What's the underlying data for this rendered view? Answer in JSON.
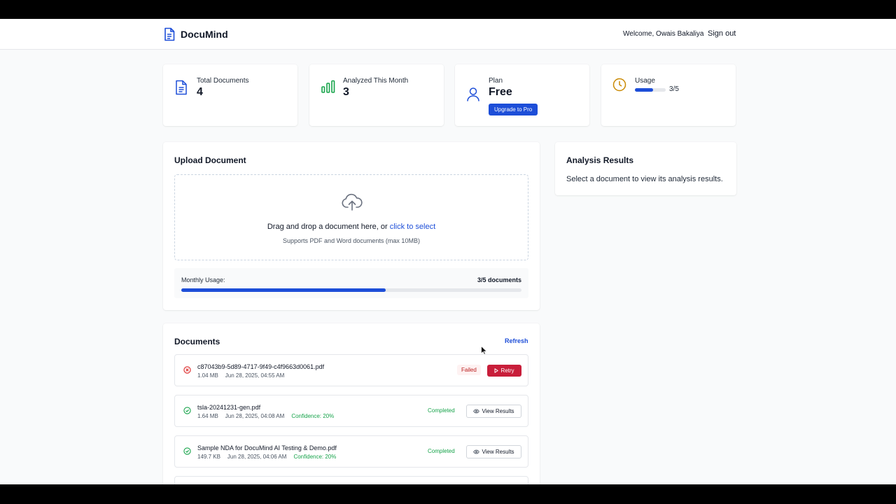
{
  "header": {
    "app_name": "DocuMind",
    "welcome": "Welcome, Owais Bakaliya",
    "sign_out": "Sign out"
  },
  "stats": {
    "total_documents": {
      "label": "Total Documents",
      "value": "4",
      "icon": "document-icon"
    },
    "analyzed": {
      "label": "Analyzed This Month",
      "value": "3",
      "icon": "bar-chart-icon"
    },
    "plan": {
      "label": "Plan",
      "value": "Free",
      "button": "Upgrade to Pro",
      "icon": "user-icon"
    },
    "usage": {
      "label": "Usage",
      "count": "3/5",
      "progress": 0.6,
      "icon": "clock-icon"
    }
  },
  "upload": {
    "title": "Upload Document",
    "drop_text": "Drag and drop a document here, or ",
    "drop_link": "click to select",
    "supports": "Supports PDF and Word documents (max 10MB)",
    "monthly_label": "Monthly Usage:",
    "monthly_count": "3/5 documents",
    "monthly_progress": 0.6
  },
  "analysis": {
    "title": "Analysis Results",
    "empty_text": "Select a document to view its analysis results."
  },
  "documents": {
    "title": "Documents",
    "refresh": "Refresh",
    "items": [
      {
        "name": "c87043b9-5d89-4717-9f49-c4f9663d0061.pdf",
        "size": "1.04 MB",
        "date": "Jun 28, 2025, 04:55 AM",
        "confidence": "",
        "status": "Failed",
        "action": "Retry"
      },
      {
        "name": "tsla-20241231-gen.pdf",
        "size": "1.64 MB",
        "date": "Jun 28, 2025, 04:08 AM",
        "confidence": "Confidence: 20%",
        "status": "Completed",
        "action": "View Results"
      },
      {
        "name": "Sample NDA for DocuMind AI Testing & Demo.pdf",
        "size": "149.7 KB",
        "date": "Jun 28, 2025, 04:06 AM",
        "confidence": "Confidence: 20%",
        "status": "Completed",
        "action": "View Results"
      }
    ]
  },
  "colors": {
    "primary": "#1d4ed8",
    "success": "#16a34a",
    "danger": "#c81e3a",
    "accent_clock": "#ca8a04"
  }
}
